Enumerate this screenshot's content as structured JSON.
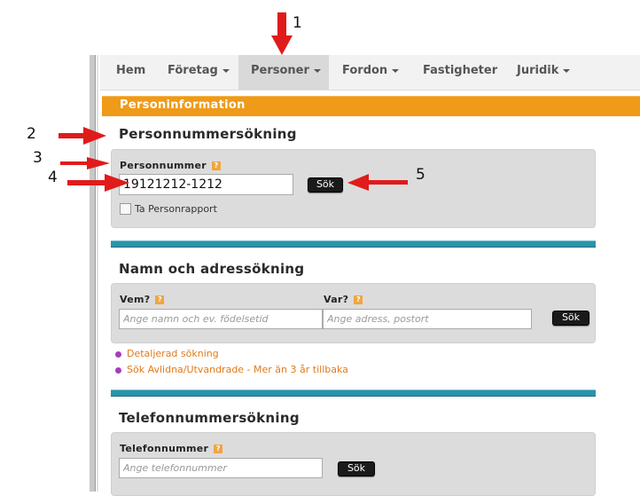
{
  "nav": {
    "items": [
      {
        "label": "Hem",
        "dropdown": false,
        "active": false
      },
      {
        "label": "Företag",
        "dropdown": true,
        "active": false
      },
      {
        "label": "Personer",
        "dropdown": true,
        "active": true
      },
      {
        "label": "Fordon",
        "dropdown": true,
        "active": false
      },
      {
        "label": "Fastigheter",
        "dropdown": false,
        "active": false
      },
      {
        "label": "Juridik",
        "dropdown": true,
        "active": false
      }
    ]
  },
  "banner": {
    "title": "Personinformation",
    "color": "#ef9a18"
  },
  "personnummer_section": {
    "title": "Personnummersökning",
    "field_label": "Personnummer",
    "help_icon": "?",
    "input_value": "19121212-1212",
    "search_button": "Sök",
    "checkbox_label": "Ta Personrapport"
  },
  "name_section": {
    "title": "Namn och adressökning",
    "who_label": "Vem?",
    "who_placeholder": "Ange namn och ev. födelsetid",
    "where_label": "Var?",
    "where_placeholder": "Ange adress, postort",
    "search_button": "Sök",
    "links": [
      "Detaljerad sökning",
      "Sök Avlidna/Utvandrade - Mer än 3 år tillbaka"
    ]
  },
  "phone_section": {
    "title": "Telefonnummersökning",
    "field_label": "Telefonnummer",
    "placeholder": "Ange telefonnummer",
    "search_button": "Sök"
  },
  "annotations": {
    "n1": "1",
    "n2": "2",
    "n3": "3",
    "n4": "4",
    "n5": "5",
    "arrow_color": "#e01b1b"
  }
}
